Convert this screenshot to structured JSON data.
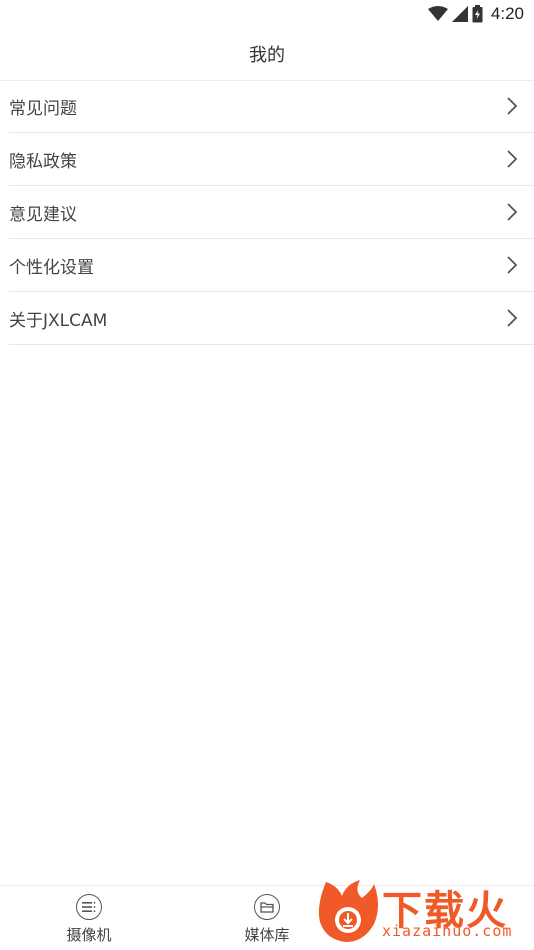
{
  "status_bar": {
    "time": "4:20",
    "icons": [
      "wifi-icon",
      "signal-icon",
      "battery-icon"
    ]
  },
  "header": {
    "title": "我的"
  },
  "menu": {
    "items": [
      {
        "label": "常见问题",
        "icon": "chevron-right-icon"
      },
      {
        "label": "隐私政策",
        "icon": "chevron-right-icon"
      },
      {
        "label": "意见建议",
        "icon": "chevron-right-icon"
      },
      {
        "label": "个性化设置",
        "icon": "chevron-right-icon"
      },
      {
        "label": "关于JXLCAM",
        "icon": "chevron-right-icon"
      }
    ]
  },
  "bottom_nav": {
    "tabs": [
      {
        "label": "摄像机",
        "icon": "camera-list-icon"
      },
      {
        "label": "媒体库",
        "icon": "folder-icon"
      }
    ]
  },
  "watermark": {
    "text": "下载火",
    "url": "xiazaihuo.com",
    "color": "#f05a28"
  },
  "colors": {
    "background": "#ffffff",
    "divider": "#e8e8e8",
    "text": "#444444",
    "accent": "#f05a28"
  }
}
